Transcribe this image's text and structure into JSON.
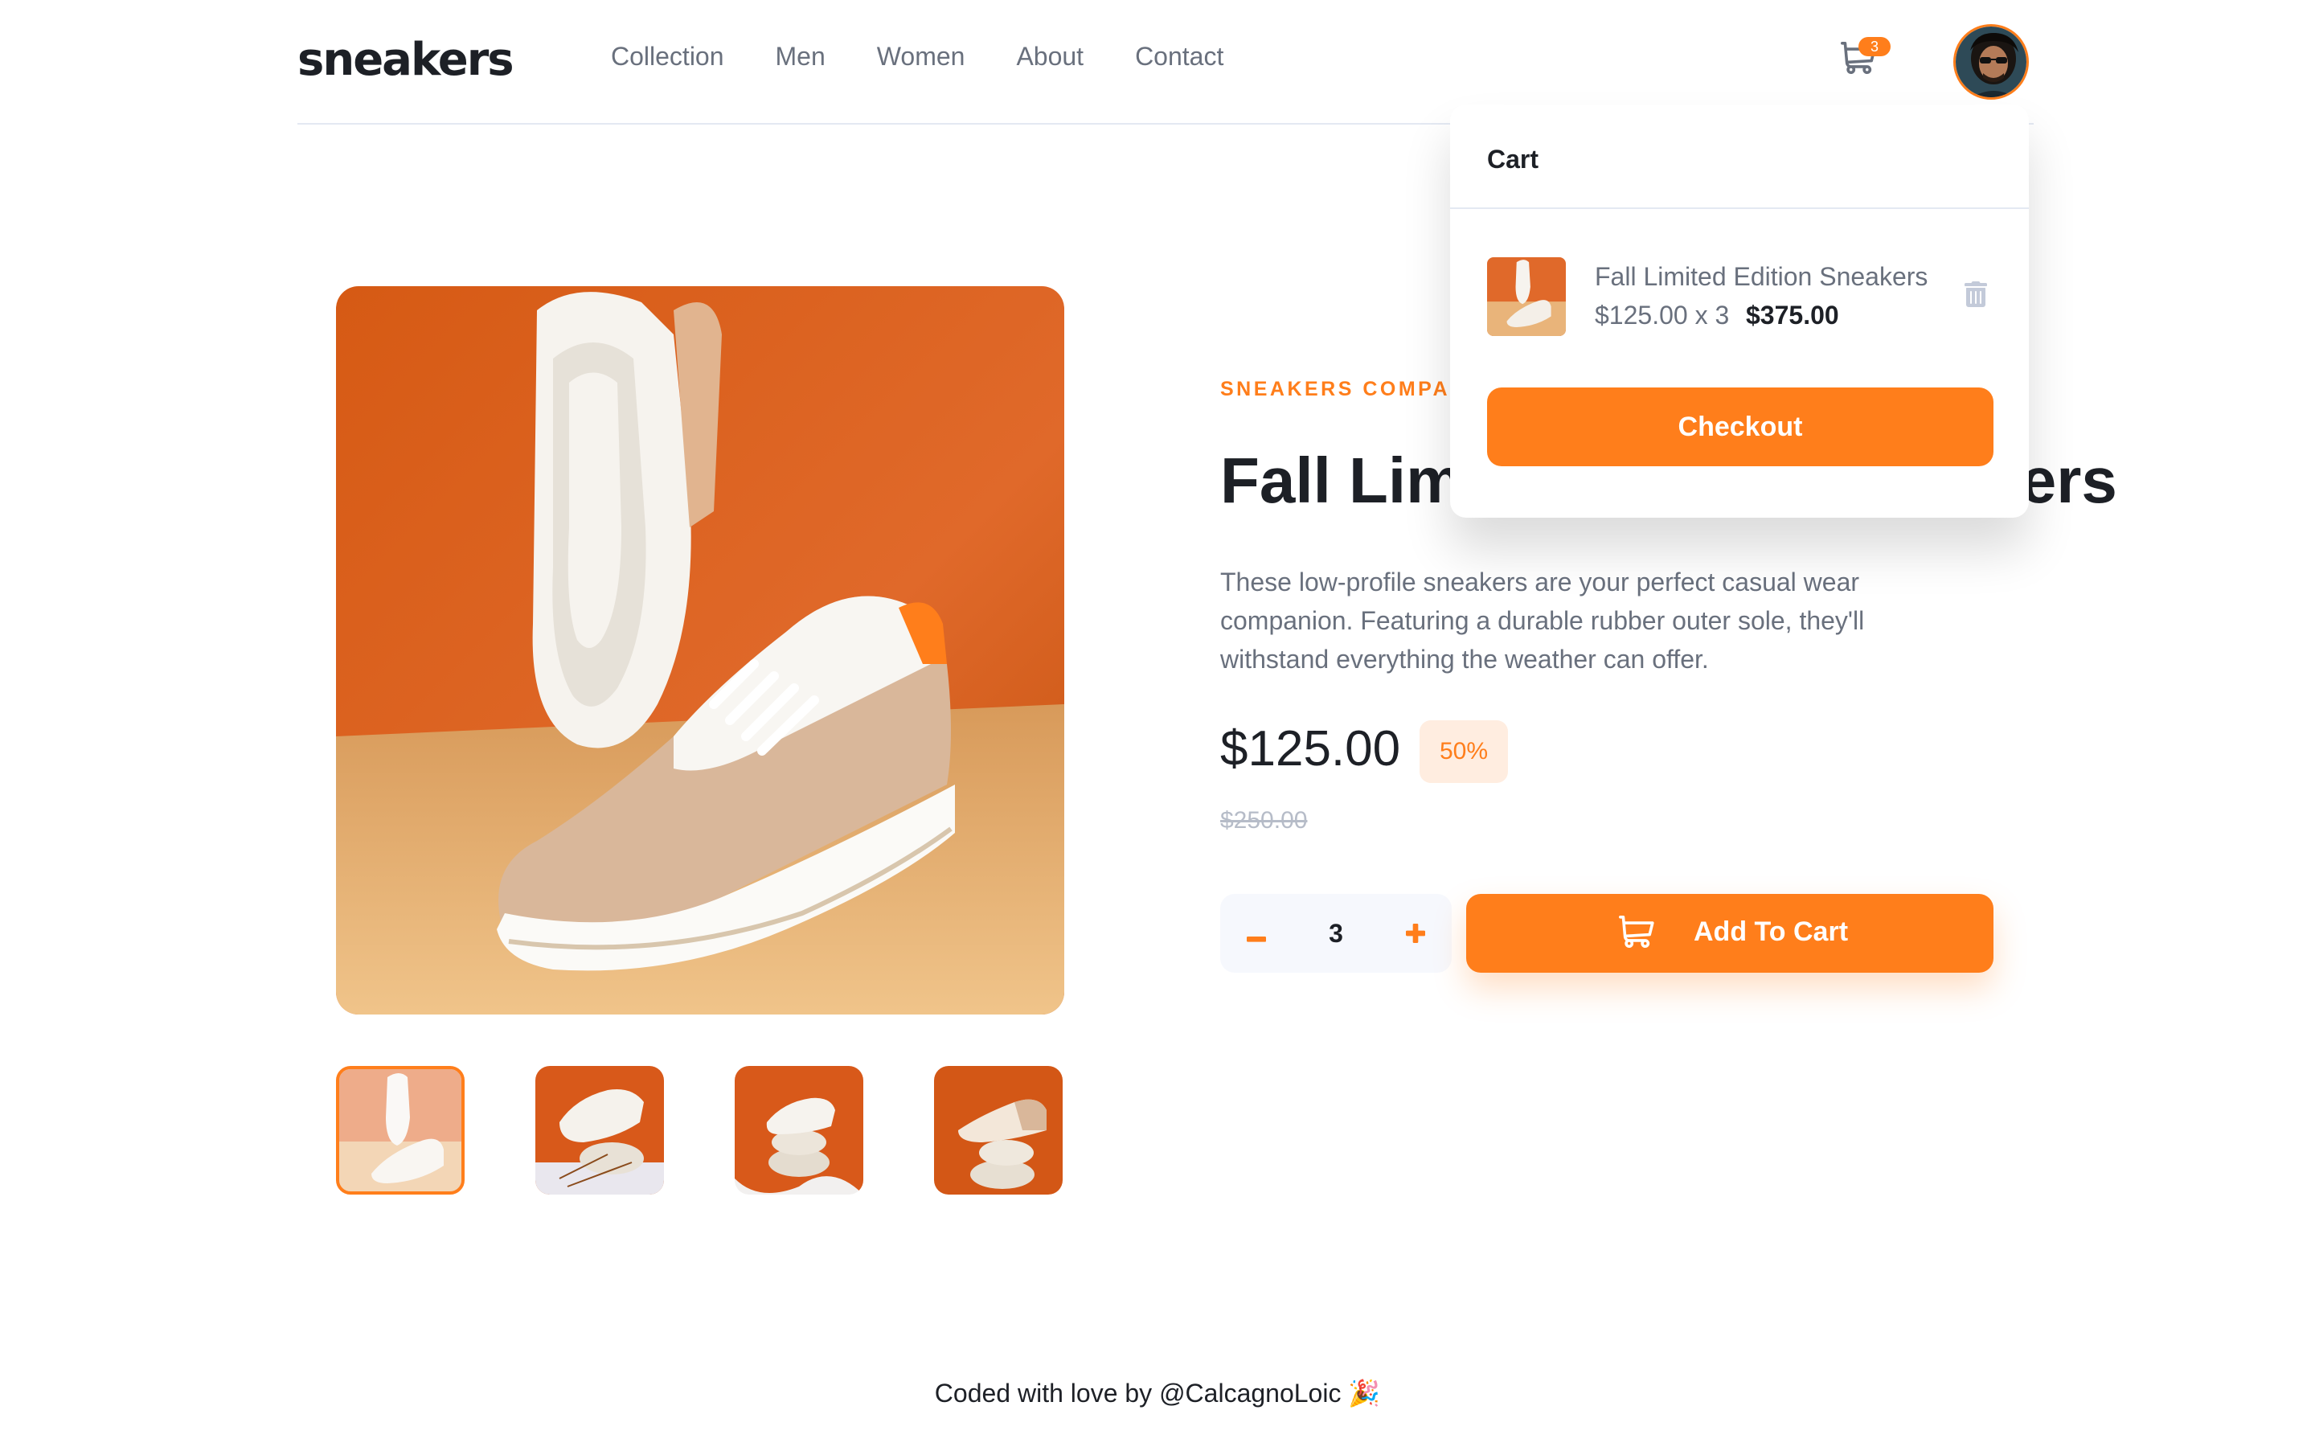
{
  "brand": {
    "logo": "sneakers",
    "accent_color": "#ff7e1b"
  },
  "nav": {
    "items": [
      {
        "label": "Collection"
      },
      {
        "label": "Men"
      },
      {
        "label": "Women"
      },
      {
        "label": "About"
      },
      {
        "label": "Contact"
      }
    ]
  },
  "header": {
    "cart_icon": "cart-icon",
    "cart_count": "3",
    "avatar_icon": "user-avatar"
  },
  "product": {
    "company": "SNEAKERS COMPANY",
    "title": "Fall Limited Edition Sneakers",
    "description": "These low-profile sneakers are your perfect casual wear companion. Featuring a durable rubber outer sole, they'll withstand everything the weather can offer.",
    "price": "$125.00",
    "discount": "50%",
    "original_price": "$250.00",
    "quantity": "3",
    "add_to_cart_label": "Add To Cart",
    "thumbnails": [
      {
        "name": "thumbnail-1",
        "active": true
      },
      {
        "name": "thumbnail-2"
      },
      {
        "name": "thumbnail-3"
      },
      {
        "name": "thumbnail-4"
      }
    ]
  },
  "cart": {
    "title": "Cart",
    "item_name": "Fall Limited Edition Sneakers",
    "item_calc": "$125.00 x 3",
    "item_total": "$375.00",
    "checkout_label": "Checkout"
  },
  "footer": {
    "text": "Coded with love by @CalcagnoLoic 🎉"
  }
}
